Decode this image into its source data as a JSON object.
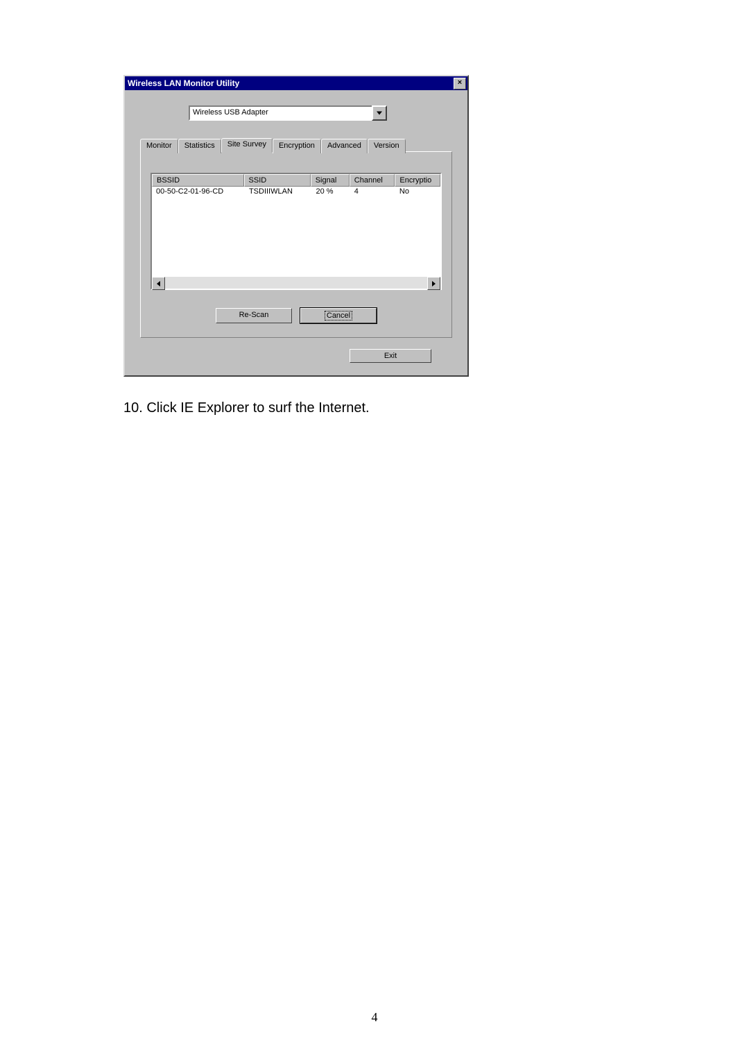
{
  "dialog": {
    "title": "Wireless LAN Monitor Utility",
    "close_label": "×",
    "adapter_dropdown": "Wireless USB Adapter",
    "tabs": [
      {
        "label": "Monitor"
      },
      {
        "label": "Statistics"
      },
      {
        "label": "Site Survey"
      },
      {
        "label": "Encryption"
      },
      {
        "label": "Advanced"
      },
      {
        "label": "Version"
      }
    ],
    "columns": {
      "bssid": "BSSID",
      "ssid": "SSID",
      "signal": "Signal",
      "channel": "Channel",
      "encryption": "Encryptio"
    },
    "rows": [
      {
        "bssid": "00-50-C2-01-96-CD",
        "ssid": "TSDIIIWLAN",
        "signal": "20 %",
        "channel": "4",
        "encryption": "No"
      }
    ],
    "buttons": {
      "rescan": "Re-Scan",
      "cancel": "Cancel",
      "exit": "Exit"
    }
  },
  "step": {
    "text": "10.  Click IE Explorer to surf the Internet."
  },
  "page_number": "4"
}
